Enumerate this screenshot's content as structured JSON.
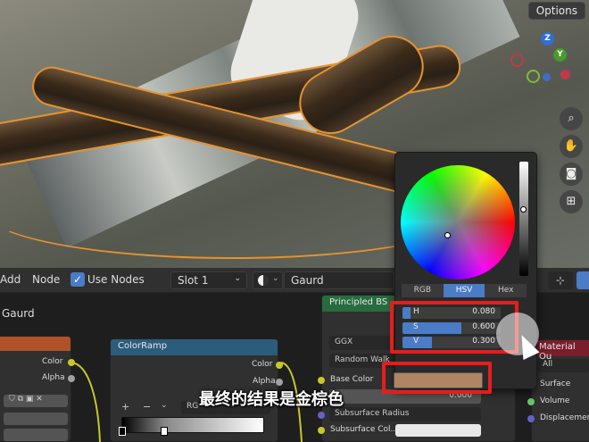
{
  "viewport": {
    "options_label": "Options",
    "gizmo": {
      "z": "Z",
      "y": "Y"
    }
  },
  "node_header": {
    "menu_add": "Add",
    "menu_node": "Node",
    "use_nodes_label": "Use Nodes",
    "slot": "Slot 1",
    "material_name": "Gaurd"
  },
  "breadcrumb": "Gaurd",
  "nodes": {
    "left": {
      "out_color": "Color",
      "out_alpha": "Alpha"
    },
    "colorramp": {
      "title": "ColorRamp",
      "out_color": "Color",
      "out_alpha": "Alpha",
      "add": "+",
      "remove": "−",
      "mode": "RG"
    },
    "principled": {
      "title": "Principled BS",
      "distribution": "GGX",
      "subsurface_method": "Random Walk",
      "inputs": [
        "Base Color",
        "Subsurface",
        "Subsurface Radius",
        "Subsurface Col..."
      ],
      "subsurface_value": "0.000"
    },
    "output": {
      "title": "Material Ou",
      "target": "All",
      "inputs": [
        "Surface",
        "Volume",
        "Displacement"
      ]
    }
  },
  "color_picker": {
    "tabs": [
      "RGB",
      "HSV",
      "Hex"
    ],
    "active_tab": "HSV",
    "hsv": [
      {
        "key": "H",
        "value": "0.080",
        "fraction": 0.08
      },
      {
        "key": "S",
        "value": "0.600",
        "fraction": 0.6
      },
      {
        "key": "V",
        "value": "0.300",
        "fraction": 0.3
      }
    ],
    "swatch_color": "#ae8663"
  },
  "subtitle": "最终的结果是金棕色",
  "colors": {
    "accent_blue": "#4a7cc7",
    "highlight_red": "#e81c1c",
    "selection_orange": "#e6932e"
  }
}
